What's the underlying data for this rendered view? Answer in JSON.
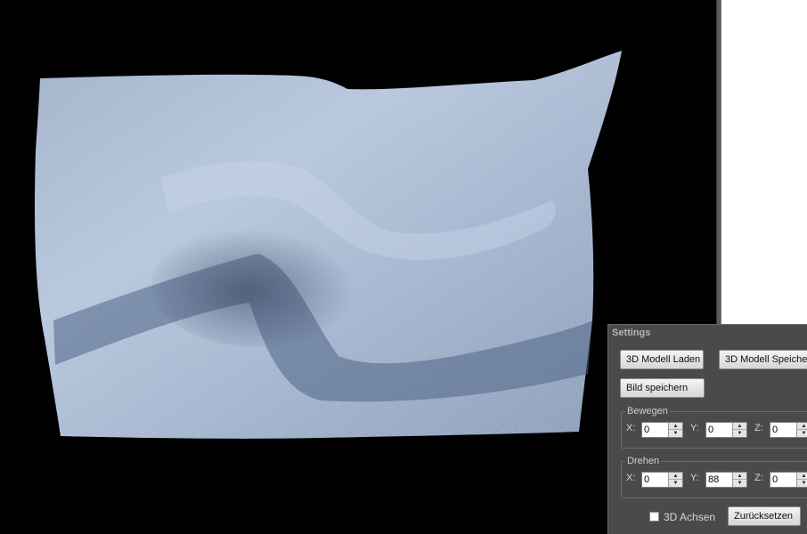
{
  "settings": {
    "title": "Settings",
    "load_model_label": "3D Modell Laden",
    "save_model_label": "3D Modell Speichern",
    "save_image_label": "Bild speichern",
    "move": {
      "legend": "Bewegen",
      "x_label": "X:",
      "x_value": "0",
      "y_label": "Y:",
      "y_value": "0",
      "z_label": "Z:",
      "z_value": "0"
    },
    "rotate": {
      "legend": "Drehen",
      "x_label": "X:",
      "x_value": "0",
      "y_label": "Y:",
      "y_value": "88",
      "z_label": "Z:",
      "z_value": "0"
    },
    "axes_checkbox_label": "3D Achsen",
    "axes_checked": false,
    "reset_label": "Zurücksetzen"
  },
  "icons": {
    "spin_up": "triangle-up-icon",
    "spin_down": "triangle-down-icon"
  },
  "colors": {
    "viewport_background": "#000000",
    "cloth_light": "#a9bcd6",
    "cloth_dark": "#5e7494",
    "panel_background": "#4a4a4a"
  }
}
